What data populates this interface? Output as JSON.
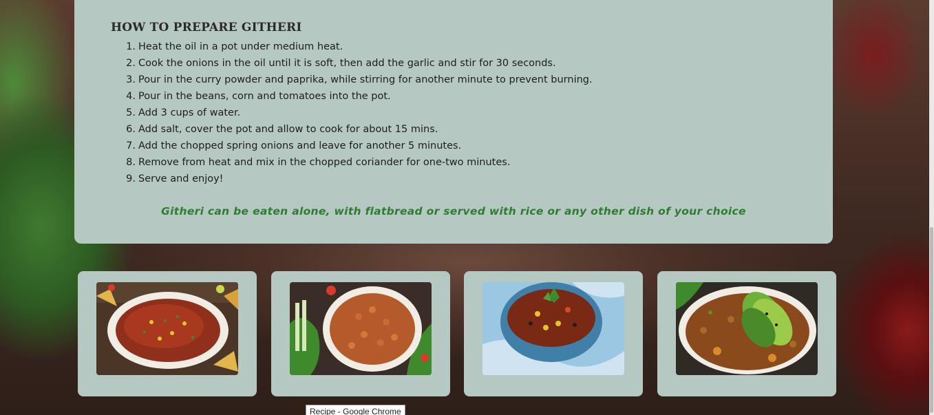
{
  "recipe": {
    "title": "HOW TO PREPARE GITHERI",
    "steps": [
      "Heat the oil in a pot under medium heat.",
      "Cook the onions in the oil until it is soft, then add the garlic and stir for 30 seconds.",
      "Pour in the curry powder and paprika, while stirring for another minute to prevent burning.",
      "Pour in the beans, corn and tomatoes into the pot.",
      "Add 3 cups of water.",
      "Add salt, cover the pot and allow to cook for about 15 mins.",
      "Add the chopped spring onions and leave for another 5 minutes.",
      "Remove from heat and mix in the chopped coriander for one-two minutes.",
      "Serve and enjoy!"
    ],
    "serving_note": "Githeri can be eaten alone, with flatbread or served with rice or any other dish of your choice"
  },
  "gallery": [
    {
      "id": "photo-1"
    },
    {
      "id": "photo-2"
    },
    {
      "id": "photo-3"
    },
    {
      "id": "photo-4"
    }
  ],
  "tooltip": {
    "text": "Recipe - Google Chrome"
  },
  "colors": {
    "card_background": "#b5c8c1",
    "note_green": "#2e7d32",
    "title_text": "#2a2a2a"
  }
}
